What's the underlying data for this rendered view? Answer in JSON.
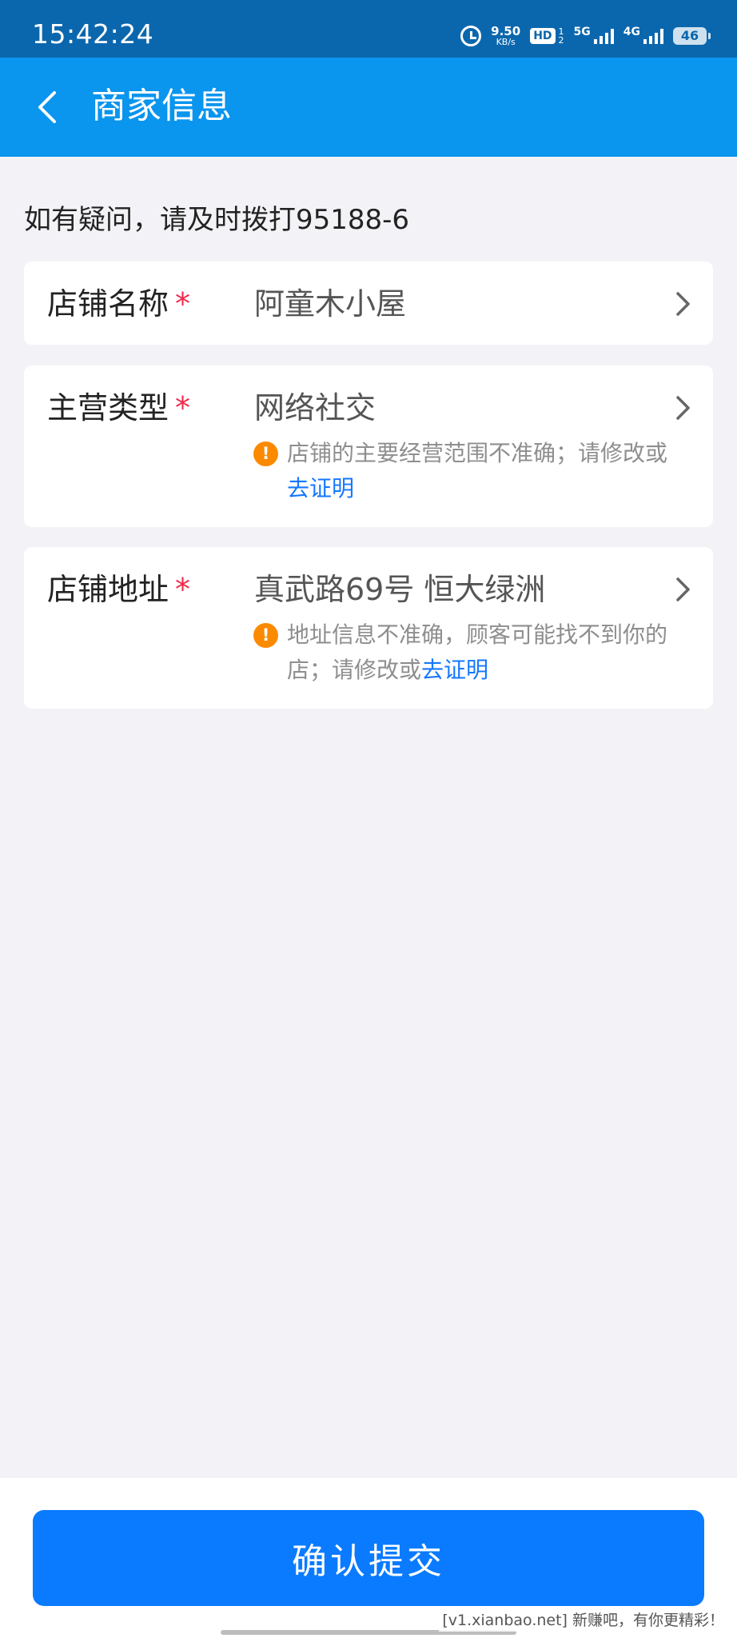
{
  "status_bar": {
    "time": "15:42:24",
    "net_speed_value": "9.50",
    "net_speed_unit": "KB/s",
    "hd_label": "HD",
    "hd_sub_top": "1",
    "hd_sub_bottom": "2",
    "net1_label": "5G",
    "net2_label": "4G",
    "battery": "46"
  },
  "header": {
    "title": "商家信息"
  },
  "notice": "如有疑问，请及时拨打95188-6",
  "required_mark": "*",
  "fields": [
    {
      "label": "店铺名称",
      "value": "阿童木小屋"
    },
    {
      "label": "主营类型",
      "value": "网络社交",
      "warning_text": "店铺的主要经营范围不准确；请修改或",
      "warning_link": "去证明"
    },
    {
      "label": "店铺地址",
      "value": "真武路69号 恒大绿洲",
      "warning_text": "地址信息不准确，顾客可能找不到你的店；请修改或",
      "warning_link": "去证明"
    }
  ],
  "warning_icon_glyph": "!",
  "submit_label": "确认提交",
  "watermark": "[v1.xianbao.net] 新赚吧，有你更精彩！",
  "colors": {
    "status_bar": "#0b67ad",
    "header": "#0a95ee",
    "primary_button": "#0a7bff",
    "link": "#1677ff",
    "required": "#f2294a",
    "warning": "#fb8a00",
    "background": "#f3f3f7"
  }
}
